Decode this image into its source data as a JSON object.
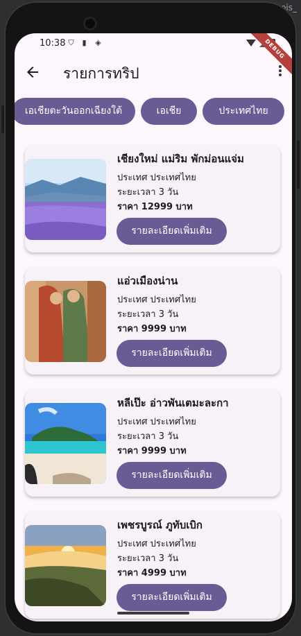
{
  "ide": {
    "title_fragment": "ois_"
  },
  "status_bar": {
    "time": "10:38",
    "debug_banner": "DEBUG"
  },
  "app_bar": {
    "title": "รายการทริป"
  },
  "chips": [
    {
      "label": "เอเชียตะวันออกเฉียงใต้"
    },
    {
      "label": "เอเชีย"
    },
    {
      "label": "ประเทศไทย"
    }
  ],
  "trips": [
    {
      "title": "เชียงใหม่ แม่ริม พักม่อนแจ่ม",
      "country": "ประเทศ ประเทศไทย",
      "duration": "ระยะเวลา 3 วัน",
      "price": "ราคา 12999 บาท",
      "button": "รายละเอียดเพิ่มเติม",
      "image": "lavender-field-mountains"
    },
    {
      "title": "แอ่วเมืองน่าน",
      "country": "ประเทศ ประเทศไทย",
      "duration": "ระยะเวลา 3 วัน",
      "price": "ราคา 9999 บาท",
      "button": "รายละเอียดเพิ่มเติม",
      "image": "wat-phumin-mural"
    },
    {
      "title": "หลีเป๊ะ อ่าวพันเตมะละกา",
      "country": "ประเทศ ประเทศไทย",
      "duration": "ระยะเวลา 3 วัน",
      "price": "ราคา 9999 บาท",
      "button": "รายละเอียดเพิ่มเติม",
      "image": "tropical-beach"
    },
    {
      "title": "เพชรบูรณ์ ภูทับเบิก",
      "country": "ประเทศ ประเทศไทย",
      "duration": "ระยะเวลา 3 วัน",
      "price": "ราคา 4999 บาท",
      "button": "รายละเอียดเพิ่มเติม",
      "image": "sunrise-mountain-fog"
    }
  ],
  "colors": {
    "primary": "#6b5b95",
    "background": "#fdf7fd",
    "card": "#f7f1f8"
  }
}
